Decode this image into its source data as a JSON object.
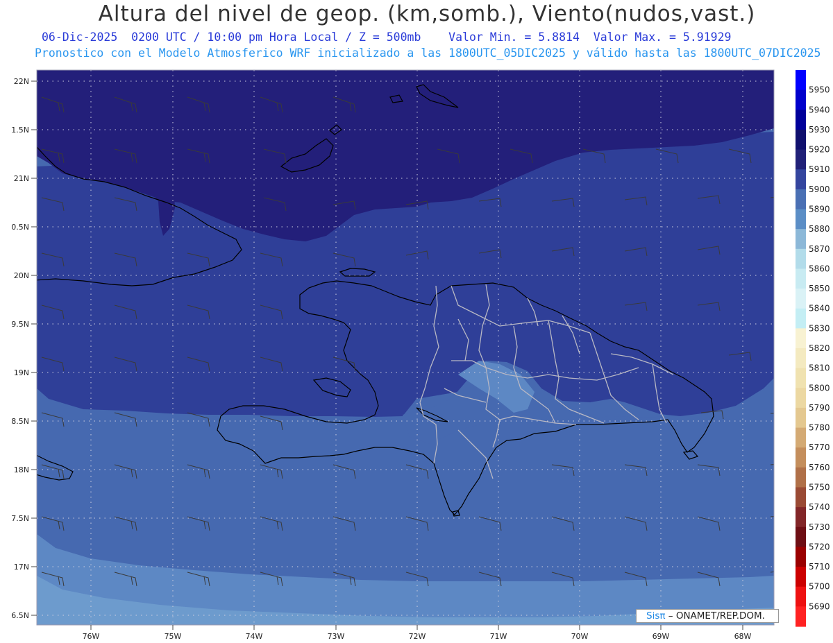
{
  "title": "Altura del nivel de geop. (km,somb.), Viento(nudos,vast.)",
  "subtitle": {
    "date": "06-Dic-2025",
    "time": "0200 UTC / 10:00 pm Hora Local / Z = 500mb",
    "min": "Valor Min. = 5.8814",
    "max": "Valor Max. = 5.91929"
  },
  "model_line": "Pronostico con el Modelo Atmosferico WRF inicializado a las 1800UTC_05DIC2025 y válido hasta las  1800UTC_07DIC2025",
  "latitude_labels": [
    "22N",
    "1.5N",
    "21N",
    "0.5N",
    "20N",
    "9.5N",
    "19N",
    "8.5N",
    "18N",
    "7.5N",
    "17N",
    "6.5N"
  ],
  "longitude_labels": [
    "76W",
    "75W",
    "74W",
    "73W",
    "72W",
    "71W",
    "70W",
    "69W",
    "68W"
  ],
  "colorbar": {
    "levels": [
      "5950",
      "5940",
      "5930",
      "5920",
      "5910",
      "5900",
      "5890",
      "5880",
      "5870",
      "5860",
      "5850",
      "5840",
      "5830",
      "5820",
      "5810",
      "5800",
      "5790",
      "5780",
      "5770",
      "5760",
      "5750",
      "5740",
      "5730",
      "5720",
      "5710",
      "5700",
      "5690"
    ],
    "colors": [
      "#0000ff",
      "#0000cc",
      "#00009a",
      "#10106e",
      "#212178",
      "#34459e",
      "#4a70b4",
      "#5b8ec6",
      "#8cb8d8",
      "#b2dcea",
      "#c8ebf2",
      "#daf2f6",
      "#c4eef4",
      "#f8f2d2",
      "#f4eac0",
      "#f0e2b0",
      "#ecd8a2",
      "#e4c890",
      "#d4aa74",
      "#c48e5c",
      "#b07048",
      "#9a4a34",
      "#822628",
      "#6e0e14",
      "#9a0000",
      "#cc0000",
      "#ee1111",
      "#ff2222"
    ]
  },
  "field_colors": {
    "h5910": "#231f7a",
    "h5900": "#2f3f98",
    "h5890": "#4669b0",
    "h5880": "#5d88c4",
    "h5870": "#7aa6d4"
  },
  "credit": {
    "brand": "Sisπ",
    "text": " – ONAMET/REP.DOM."
  }
}
